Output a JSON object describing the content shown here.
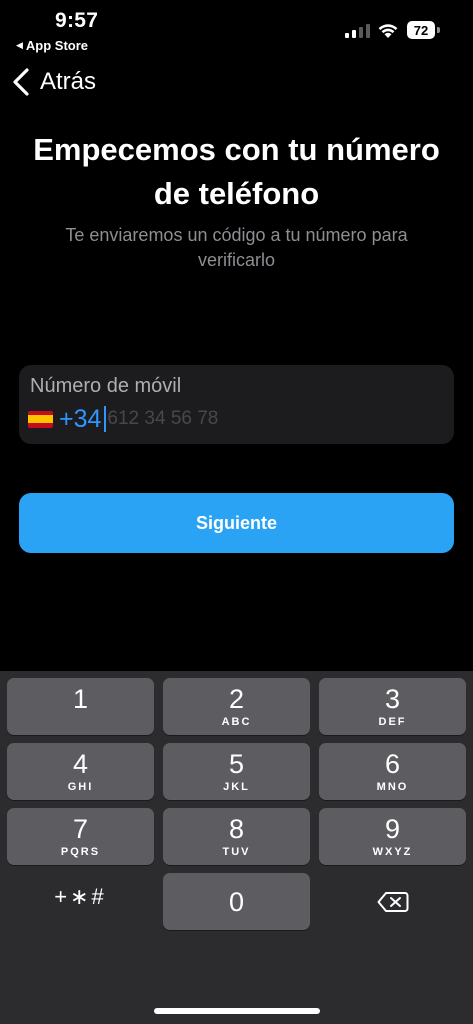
{
  "status_bar": {
    "time": "9:57",
    "back_app": "App Store",
    "battery": "72"
  },
  "nav": {
    "back_label": "Atrás"
  },
  "header": {
    "title_line1": "Empecemos con tu número",
    "title_line2": "de teléfono",
    "subtitle_line1": "Te enviaremos un código a tu número para",
    "subtitle_line2": "verificarlo"
  },
  "phone_field": {
    "label": "Número de móvil",
    "country_flag": "spain-flag-icon",
    "dial_code": "+34",
    "placeholder": "612 34 56 78"
  },
  "next_button": {
    "label": "Siguiente",
    "color": "#2aa3f5"
  },
  "keypad": {
    "keys": [
      {
        "digit": "1",
        "letters": ""
      },
      {
        "digit": "2",
        "letters": "ABC"
      },
      {
        "digit": "3",
        "letters": "DEF"
      },
      {
        "digit": "4",
        "letters": "GHI"
      },
      {
        "digit": "5",
        "letters": "JKL"
      },
      {
        "digit": "6",
        "letters": "MNO"
      },
      {
        "digit": "7",
        "letters": "PQRS"
      },
      {
        "digit": "8",
        "letters": "TUV"
      },
      {
        "digit": "9",
        "letters": "WXYZ"
      }
    ],
    "symbols": "+∗#",
    "zero": "0",
    "delete_icon": "backspace-icon"
  }
}
